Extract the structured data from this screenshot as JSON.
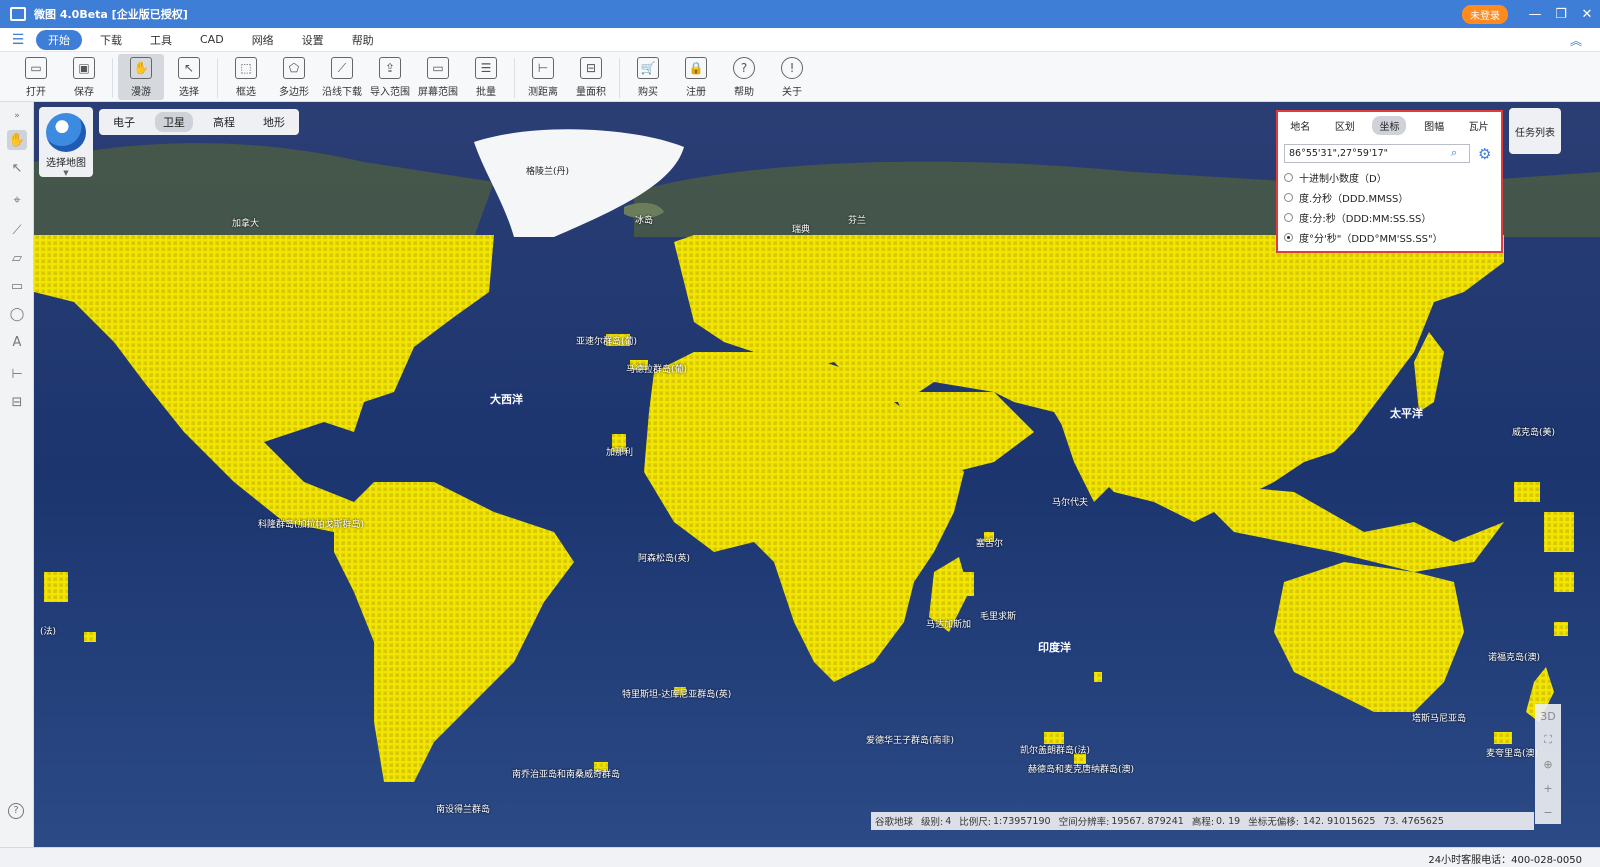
{
  "window": {
    "title": "微图 4.0Beta [企业版已授权]",
    "login_label": "未登录",
    "min_label": "—",
    "restore_label": "❐",
    "close_label": "✕"
  },
  "menu": {
    "items": [
      "开始",
      "下载",
      "工具",
      "CAD",
      "网络",
      "设置",
      "帮助"
    ]
  },
  "toolbar": {
    "tools": [
      {
        "label": "打开",
        "icon": "folder-icon"
      },
      {
        "label": "保存",
        "icon": "save-icon"
      },
      {
        "label": "漫游",
        "icon": "hand-icon",
        "active": true
      },
      {
        "label": "选择",
        "icon": "cursor-icon"
      },
      {
        "label": "框选",
        "icon": "box-select-icon"
      },
      {
        "label": "多边形",
        "icon": "polygon-icon"
      },
      {
        "label": "沿线下载",
        "icon": "line-download-icon"
      },
      {
        "label": "导入范围",
        "icon": "import-icon"
      },
      {
        "label": "屏幕范围",
        "icon": "screen-icon"
      },
      {
        "label": "批量",
        "icon": "batch-icon"
      },
      {
        "label": "测距离",
        "icon": "ruler-icon"
      },
      {
        "label": "量面积",
        "icon": "area-icon"
      },
      {
        "label": "购买",
        "icon": "cart-icon"
      },
      {
        "label": "注册",
        "icon": "lock-icon"
      },
      {
        "label": "帮助",
        "icon": "help-icon"
      },
      {
        "label": "关于",
        "icon": "info-icon"
      }
    ]
  },
  "map_types": {
    "items": [
      "电子",
      "卫星",
      "高程",
      "地形"
    ],
    "selected": "卫星",
    "choose_label": "选择地图"
  },
  "search_panel": {
    "tabs": [
      "地名",
      "区划",
      "坐标",
      "图幅",
      "瓦片"
    ],
    "active_tab": "坐标",
    "input_value": "86°55'31\",27°59'17\"",
    "options": [
      {
        "label": "十进制小数度（D）",
        "selected": false
      },
      {
        "label": "度.分秒（DDD.MMSS）",
        "selected": false
      },
      {
        "label": "度:分:秒（DDD:MM:SS.SS）",
        "selected": false
      },
      {
        "label": "度°分'秒\"（DDD°MM'SS.SS\"）",
        "selected": true
      }
    ]
  },
  "task_list_label": "任务列表",
  "map_labels": {
    "greenland": "格陵兰(丹)",
    "canada": "加拿大",
    "iceland": "冰岛",
    "sweden": "瑞典",
    "finland": "芬兰",
    "atlantic": "大西洋",
    "pacific": "太平洋",
    "indian": "印度洋",
    "azores": "亚速尔群岛(葡)",
    "madeira": "马德拉群岛(葡)",
    "canary": "加那利",
    "galapagos": "科隆群岛(加拉帕戈斯群岛)",
    "ascension": "阿森松岛(英)",
    "tristan": "特里斯坦-达库尼亚群岛(英)",
    "south_georgia": "南乔治亚岛和南桑威奇群岛",
    "south_shetland": "南设得兰群岛",
    "maldives": "马尔代夫",
    "seychelles": "塞舌尔",
    "mauritius": "毛里求斯",
    "madagascar": "马达加斯加",
    "prince_edward": "爱德华王子群岛(南非)",
    "kerguelen": "凯尔盖朗群岛(法)",
    "heard": "赫德岛和麦克唐纳群岛(澳)",
    "wake": "威克岛(美)",
    "french": "(法)",
    "norfolk": "诺福克岛(澳)",
    "tasmania": "塔斯马尼亚岛",
    "macquarie": "麦夸里岛(澳)"
  },
  "status": {
    "source": "谷歌地球",
    "level_label": "级别:",
    "level": "4",
    "scale_label": "比例尺:",
    "scale": "1:73957190",
    "resolution_label": "空间分辨率:",
    "resolution": "19567. 879241",
    "elevation_label": "高程:",
    "elevation": "0. 19",
    "coord_label": "坐标无偏移:",
    "lon": "142. 91015625",
    "lat": "73. 4765625"
  },
  "hotline": "24小时客服电话：400-028-0050",
  "nav_controls": [
    "3D",
    "⛶",
    "⊕",
    "+",
    "−"
  ],
  "colors": {
    "titlebar": "#3f7ed6",
    "tile_grid": "#f2e600",
    "ocean": "#1d3a7a",
    "highlight_border": "#e23b3b"
  }
}
